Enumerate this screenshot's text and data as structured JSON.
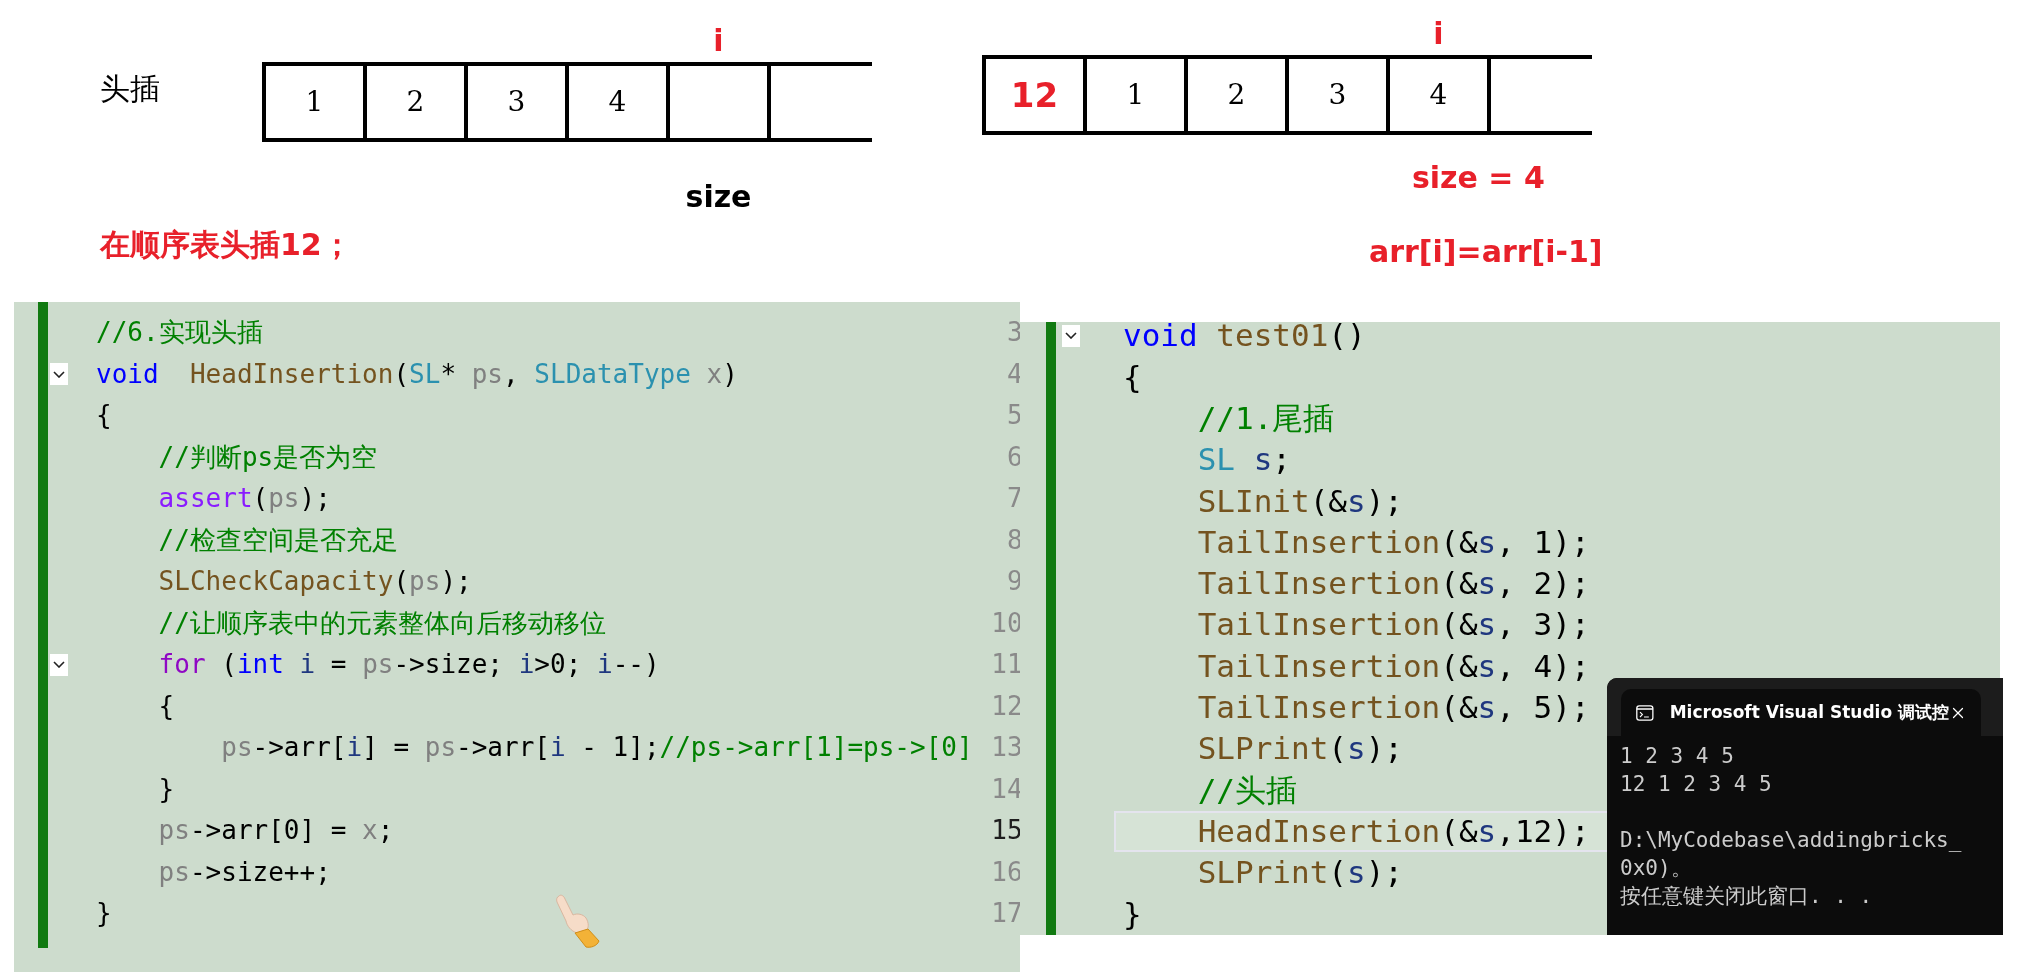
{
  "diagrams": [
    {
      "label": "头插",
      "cells": [
        {
          "kind": "value",
          "text": "1"
        },
        {
          "kind": "value",
          "text": "2"
        },
        {
          "kind": "value",
          "text": "3"
        },
        {
          "kind": "value",
          "text": "4"
        },
        {
          "kind": "empty",
          "pointer": "i",
          "below": {
            "text": "size",
            "emphasis": false
          }
        },
        {
          "kind": "empty"
        }
      ],
      "note": "在顺序表头插12；"
    },
    {
      "cells": [
        {
          "kind": "inserted",
          "text": "12"
        },
        {
          "kind": "value",
          "text": "1"
        },
        {
          "kind": "value",
          "text": "2"
        },
        {
          "kind": "value",
          "text": "3"
        },
        {
          "kind": "value",
          "text": "4",
          "pointer": "i",
          "below": {
            "text": "size = 4",
            "emphasis": true
          }
        },
        {
          "kind": "empty"
        }
      ],
      "note": "arr[i]=arr[i-1]"
    }
  ],
  "editors": [
    {
      "lines": [
        {
          "number": "3",
          "fold": false,
          "current": false,
          "tokens": [
            {
              "kind": "comment",
              "text": "//6.实现头插"
            }
          ]
        },
        {
          "number": "4",
          "fold": true,
          "current": false,
          "tokens": [
            {
              "kind": "keyword",
              "text": "void"
            },
            {
              "kind": "function",
              "text": "  HeadInsertion"
            },
            {
              "kind": "plain",
              "text": "("
            },
            {
              "kind": "type",
              "text": "SL"
            },
            {
              "kind": "plain",
              "text": "* "
            },
            {
              "kind": "param",
              "text": "ps"
            },
            {
              "kind": "plain",
              "text": ", "
            },
            {
              "kind": "type",
              "text": "SLDataType"
            },
            {
              "kind": "param",
              "text": " x"
            },
            {
              "kind": "plain",
              "text": ")"
            }
          ]
        },
        {
          "number": "5",
          "fold": false,
          "current": false,
          "tokens": [
            {
              "kind": "plain",
              "text": "{"
            }
          ]
        },
        {
          "number": "6",
          "fold": false,
          "current": false,
          "tokens": [
            {
              "kind": "comment",
              "text": "    //判断ps是否为空"
            }
          ]
        },
        {
          "number": "7",
          "fold": false,
          "current": false,
          "tokens": [
            {
              "kind": "macro",
              "text": "    assert"
            },
            {
              "kind": "plain",
              "text": "("
            },
            {
              "kind": "param",
              "text": "ps"
            },
            {
              "kind": "plain",
              "text": ");"
            }
          ]
        },
        {
          "number": "8",
          "fold": false,
          "current": false,
          "tokens": [
            {
              "kind": "comment",
              "text": "    //检查空间是否充足"
            }
          ]
        },
        {
          "number": "9",
          "fold": false,
          "current": false,
          "tokens": [
            {
              "kind": "function",
              "text": "    SLCheckCapacity"
            },
            {
              "kind": "plain",
              "text": "("
            },
            {
              "kind": "param",
              "text": "ps"
            },
            {
              "kind": "plain",
              "text": ");"
            }
          ]
        },
        {
          "number": "10",
          "fold": false,
          "current": false,
          "tokens": [
            {
              "kind": "comment",
              "text": "    //让顺序表中的元素整体向后移动移位"
            }
          ]
        },
        {
          "number": "11",
          "fold": true,
          "current": false,
          "tokens": [
            {
              "kind": "control",
              "text": "    for"
            },
            {
              "kind": "plain",
              "text": " ("
            },
            {
              "kind": "keyword",
              "text": "int"
            },
            {
              "kind": "local",
              "text": " i"
            },
            {
              "kind": "plain",
              "text": " = "
            },
            {
              "kind": "param",
              "text": "ps"
            },
            {
              "kind": "plain",
              "text": "->size; "
            },
            {
              "kind": "local",
              "text": "i"
            },
            {
              "kind": "plain",
              "text": ">0; "
            },
            {
              "kind": "local",
              "text": "i"
            },
            {
              "kind": "plain",
              "text": "--)"
            }
          ]
        },
        {
          "number": "12",
          "fold": false,
          "current": false,
          "tokens": [
            {
              "kind": "plain",
              "text": "    {"
            }
          ]
        },
        {
          "number": "13",
          "fold": false,
          "current": false,
          "tokens": [
            {
              "kind": "param",
              "text": "        ps"
            },
            {
              "kind": "plain",
              "text": "->arr["
            },
            {
              "kind": "local",
              "text": "i"
            },
            {
              "kind": "plain",
              "text": "] = "
            },
            {
              "kind": "param",
              "text": "ps"
            },
            {
              "kind": "plain",
              "text": "->arr["
            },
            {
              "kind": "local",
              "text": "i"
            },
            {
              "kind": "plain",
              "text": " - 1];"
            },
            {
              "kind": "comment",
              "text": "//ps->arr[1]=ps->[0]"
            }
          ]
        },
        {
          "number": "14",
          "fold": false,
          "current": false,
          "tokens": [
            {
              "kind": "plain",
              "text": "    }"
            }
          ]
        },
        {
          "number": "15",
          "fold": false,
          "current": true,
          "tokens": [
            {
              "kind": "param",
              "text": "    ps"
            },
            {
              "kind": "plain",
              "text": "->arr[0] = "
            },
            {
              "kind": "param",
              "text": "x"
            },
            {
              "kind": "plain",
              "text": ";"
            }
          ]
        },
        {
          "number": "16",
          "fold": false,
          "current": false,
          "tokens": [
            {
              "kind": "param",
              "text": "    ps"
            },
            {
              "kind": "plain",
              "text": "->size++;"
            }
          ]
        },
        {
          "number": "17",
          "fold": false,
          "current": false,
          "tokens": [
            {
              "kind": "plain",
              "text": "}"
            }
          ]
        }
      ]
    },
    {
      "lines": [
        {
          "fold": true,
          "highlighted": false,
          "tokens": [
            {
              "kind": "keyword",
              "text": "void"
            },
            {
              "kind": "function",
              "text": " test01"
            },
            {
              "kind": "plain",
              "text": "()"
            }
          ]
        },
        {
          "fold": false,
          "highlighted": false,
          "tokens": [
            {
              "kind": "plain",
              "text": "{"
            }
          ]
        },
        {
          "fold": false,
          "highlighted": false,
          "tokens": [
            {
              "kind": "comment",
              "text": "    //1.尾插"
            }
          ]
        },
        {
          "fold": false,
          "highlighted": false,
          "tokens": [
            {
              "kind": "type",
              "text": "    SL"
            },
            {
              "kind": "local",
              "text": " s"
            },
            {
              "kind": "plain",
              "text": ";"
            }
          ]
        },
        {
          "fold": false,
          "highlighted": false,
          "tokens": [
            {
              "kind": "function",
              "text": "    SLInit"
            },
            {
              "kind": "plain",
              "text": "(&"
            },
            {
              "kind": "local",
              "text": "s"
            },
            {
              "kind": "plain",
              "text": ");"
            }
          ]
        },
        {
          "fold": false,
          "highlighted": false,
          "tokens": [
            {
              "kind": "function",
              "text": "    TailInsertion"
            },
            {
              "kind": "plain",
              "text": "(&"
            },
            {
              "kind": "local",
              "text": "s"
            },
            {
              "kind": "plain",
              "text": ", 1);"
            }
          ]
        },
        {
          "fold": false,
          "highlighted": false,
          "tokens": [
            {
              "kind": "function",
              "text": "    TailInsertion"
            },
            {
              "kind": "plain",
              "text": "(&"
            },
            {
              "kind": "local",
              "text": "s"
            },
            {
              "kind": "plain",
              "text": ", 2);"
            }
          ]
        },
        {
          "fold": false,
          "highlighted": false,
          "tokens": [
            {
              "kind": "function",
              "text": "    TailInsertion"
            },
            {
              "kind": "plain",
              "text": "(&"
            },
            {
              "kind": "local",
              "text": "s"
            },
            {
              "kind": "plain",
              "text": ", 3);"
            }
          ]
        },
        {
          "fold": false,
          "highlighted": false,
          "tokens": [
            {
              "kind": "function",
              "text": "    TailInsertion"
            },
            {
              "kind": "plain",
              "text": "(&"
            },
            {
              "kind": "local",
              "text": "s"
            },
            {
              "kind": "plain",
              "text": ", 4);"
            }
          ]
        },
        {
          "fold": false,
          "highlighted": false,
          "tokens": [
            {
              "kind": "function",
              "text": "    TailInsertion"
            },
            {
              "kind": "plain",
              "text": "(&"
            },
            {
              "kind": "local",
              "text": "s"
            },
            {
              "kind": "plain",
              "text": ", 5);"
            }
          ]
        },
        {
          "fold": false,
          "highlighted": false,
          "tokens": [
            {
              "kind": "function",
              "text": "    SLPrint"
            },
            {
              "kind": "plain",
              "text": "("
            },
            {
              "kind": "local",
              "text": "s"
            },
            {
              "kind": "plain",
              "text": ");"
            }
          ]
        },
        {
          "fold": false,
          "highlighted": false,
          "tokens": [
            {
              "kind": "comment",
              "text": "    //头插"
            }
          ]
        },
        {
          "fold": false,
          "highlighted": true,
          "tokens": [
            {
              "kind": "function",
              "text": "    HeadInsertion"
            },
            {
              "kind": "plain",
              "text": "(&"
            },
            {
              "kind": "local",
              "text": "s"
            },
            {
              "kind": "plain",
              "text": ",12);"
            }
          ]
        },
        {
          "fold": false,
          "highlighted": false,
          "tokens": [
            {
              "kind": "function",
              "text": "    SLPrint"
            },
            {
              "kind": "plain",
              "text": "("
            },
            {
              "kind": "local",
              "text": "s"
            },
            {
              "kind": "plain",
              "text": ");"
            }
          ]
        },
        {
          "fold": false,
          "highlighted": false,
          "tokens": [
            {
              "kind": "plain",
              "text": "}"
            }
          ]
        }
      ]
    }
  ],
  "terminal": {
    "title": "Microsoft Visual Studio 调试控",
    "output": [
      {
        "text": "1 2 3 4 5",
        "gap_before": false
      },
      {
        "text": "12 1 2 3 4 5",
        "gap_before": false
      },
      {
        "text": "D:\\MyCodebase\\addingbricks_",
        "gap_before": true
      },
      {
        "text": "0x0)。",
        "gap_before": false
      },
      {
        "text": "按任意键关闭此窗口. . .",
        "gap_before": false
      }
    ]
  }
}
